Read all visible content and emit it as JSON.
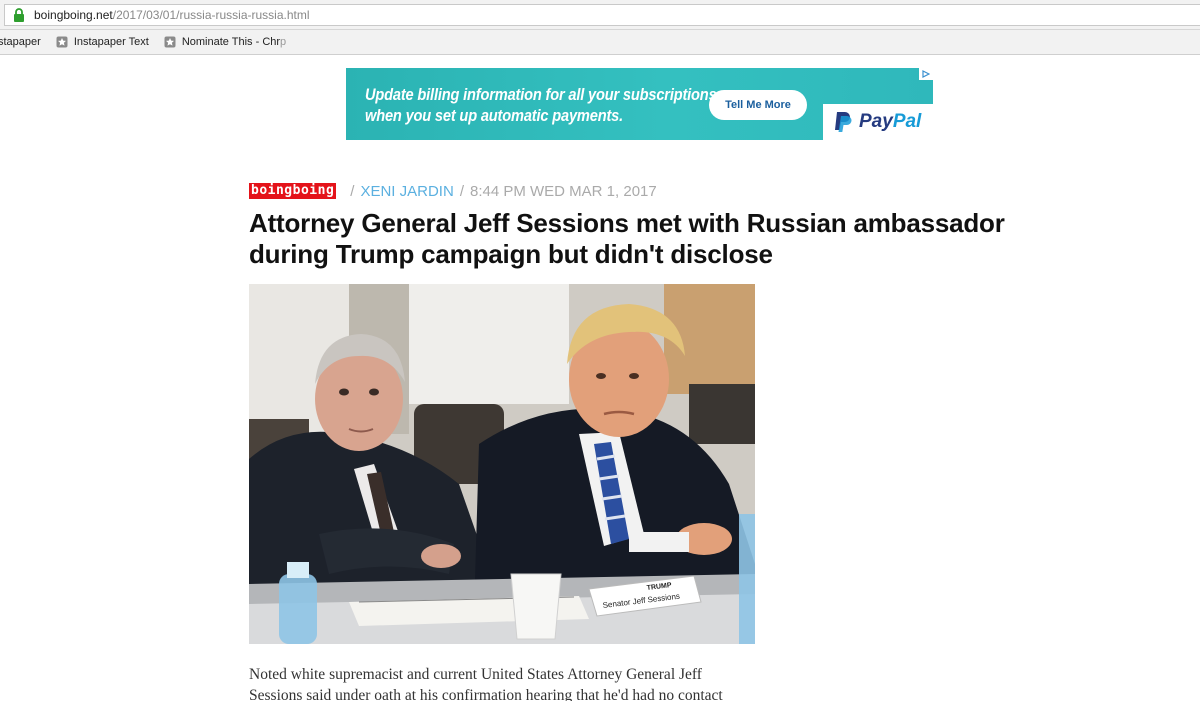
{
  "browser": {
    "url_host": "boingboing.net",
    "url_path": "/2017/03/01/russia-russia-russia.html",
    "bookmarks": [
      {
        "label": "stapaper"
      },
      {
        "label": "Instapaper Text"
      },
      {
        "label": "Nominate This - Chr",
        "faded_suffix": "p"
      }
    ]
  },
  "ad": {
    "line1": "Update billing information for all your subscriptions",
    "line2": "when you set up automatic payments.",
    "button_label": "Tell Me More",
    "brand": {
      "pay": "Pay",
      "pal": "Pal"
    }
  },
  "article": {
    "site_logo": "boingboing",
    "author": "XENI JARDIN",
    "timestamp": "8:44 PM WED MAR 1, 2017",
    "headline": "Attorney General Jeff Sessions met with Russian ambassador during Trump campaign but didn't disclose",
    "photo_nameplate": "Senator Jeff Sessions",
    "photo_nameplate2": "TRUMP",
    "body_line1": "Noted white supremacist and current United States Attorney General Jeff",
    "body_line2": "Sessions said under oath at his confirmation hearing that he'd had no contact"
  },
  "colors": {
    "brand_red": "#e4131a",
    "author_blue": "#5bb0e0",
    "ad_teal": "#34c0c0",
    "paypal_dark": "#253b80",
    "paypal_light": "#179bd7"
  }
}
